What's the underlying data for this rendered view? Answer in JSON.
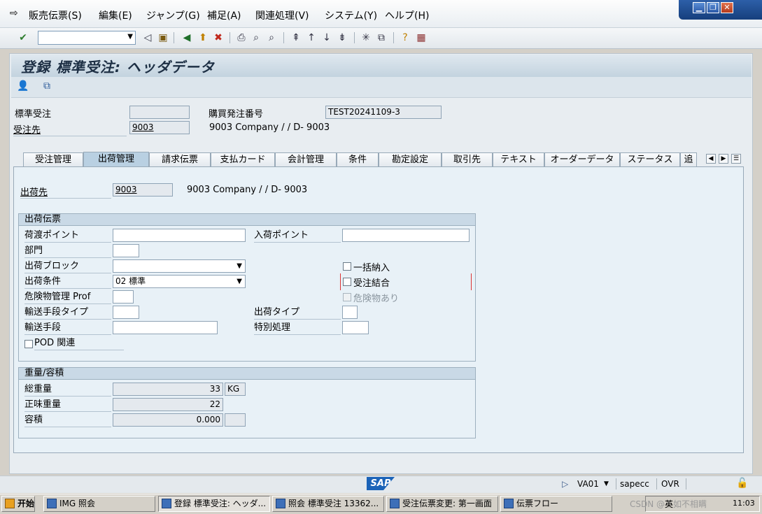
{
  "menu": {
    "items": [
      "販売伝票(S)",
      "編集(E)",
      "ジャンプ(G)",
      "補足(A)",
      "関連処理(V)",
      "システム(Y)",
      "ヘルプ(H)"
    ]
  },
  "window_controls": {
    "minimize": "▁",
    "restore": "❐",
    "close": "✕"
  },
  "title": "登録 標準受注: ヘッダデータ",
  "header": {
    "doc_type_label": "標準受注",
    "doc_type_value": "",
    "po_label": "購買発注番号",
    "po_value": "TEST20241109-3",
    "sold_to_label": "受注先",
    "sold_to_value": "9003",
    "sold_to_desc": "9003 Company / / D- 9003"
  },
  "tabs": [
    "受注管理",
    "出荷管理",
    "請求伝票",
    "支払カード",
    "会計管理",
    "条件",
    "勘定設定",
    "取引先",
    "テキスト",
    "オーダーデータ",
    "ステータス",
    "追"
  ],
  "active_tab": "出荷管理",
  "ship_to": {
    "label": "出荷先",
    "value": "9003",
    "desc": "9003 Company / / D- 9003"
  },
  "shipping_group": {
    "title": "出荷伝票",
    "shipping_point_label": "荷渡ポイント",
    "shipping_point_value": "",
    "receiving_point_label": "入荷ポイント",
    "receiving_point_value": "",
    "department_label": "部門",
    "department_value": "",
    "delivery_block_label": "出荷ブロック",
    "delivery_block_value": "",
    "complete_delivery_label": "一括納入",
    "shipping_cond_label": "出荷条件",
    "shipping_cond_value": "02 標準",
    "order_combination_label": "受注結合",
    "dg_profile_label": "危険物管理 Prof",
    "dg_profile_value": "",
    "dangerous_goods_label": "危険物あり",
    "transport_type_label": "輸送手段タイプ",
    "transport_type_value": "",
    "shipping_type_label": "出荷タイプ",
    "shipping_type_value": "",
    "transport_means_label": "輸送手段",
    "transport_means_value": "",
    "special_proc_label": "特別処理",
    "special_proc_value": "",
    "pod_label": "POD 関連"
  },
  "weight_group": {
    "title": "重量/容積",
    "total_weight_label": "総重量",
    "total_weight_value": "33",
    "weight_unit": "KG",
    "net_weight_label": "正味重量",
    "net_weight_value": "22",
    "volume_label": "容積",
    "volume_value": "0.000",
    "volume_unit": ""
  },
  "statusbar": {
    "logo": "SAP",
    "transaction": "VA01",
    "system": "sapecc",
    "mode": "OVR"
  },
  "taskbar": {
    "start": "开始",
    "tasks": [
      "IMG 照会",
      "登録 標準受注: ヘッダ...",
      "照会 標準受注 13362...",
      "受注伝票変更: 第一画面",
      "伝票フロー"
    ],
    "tray_lang": "英",
    "tray_time": "11:03",
    "watermark": "CSDN @不如不相瞒"
  }
}
